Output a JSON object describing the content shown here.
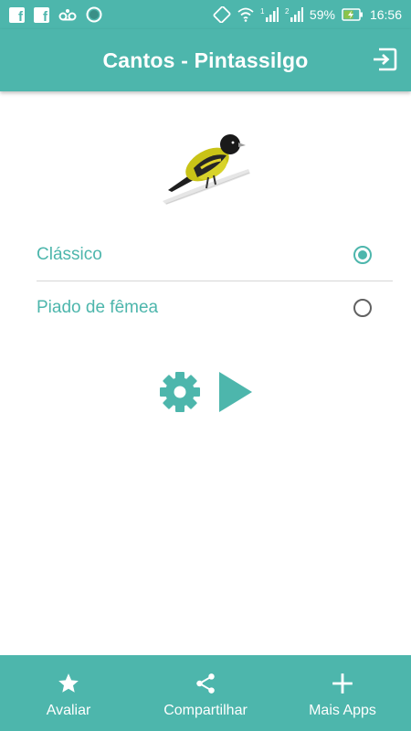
{
  "status_bar": {
    "left_icons": [
      "facebook-icon",
      "facebook-icon",
      "voicemail-icon",
      "circle-notification-icon"
    ],
    "right_icons": [
      "screen-rotation-icon",
      "wifi-icon",
      "sim1-signal-icon",
      "sim2-signal-icon",
      "battery-charging-icon"
    ],
    "sim1_label": "1",
    "sim2_label": "2",
    "battery_percent": "59%",
    "time": "16:56"
  },
  "app_bar": {
    "title": "Cantos - Pintassilgo",
    "exit_icon": "exit-icon"
  },
  "options": [
    {
      "label": "Clássico",
      "selected": true
    },
    {
      "label": "Piado de fêmea",
      "selected": false
    }
  ],
  "controls": {
    "settings_icon": "gear-icon",
    "play_icon": "play-icon"
  },
  "bottom_nav": {
    "items": [
      {
        "label": "Avaliar",
        "icon": "star-icon"
      },
      {
        "label": "Compartilhar",
        "icon": "share-icon"
      },
      {
        "label": "Mais Apps",
        "icon": "plus-icon"
      }
    ]
  },
  "colors": {
    "primary": "#4db6ac",
    "on_primary": "#ffffff",
    "divider": "#d6d6d6",
    "radio_unchecked": "#616161"
  }
}
